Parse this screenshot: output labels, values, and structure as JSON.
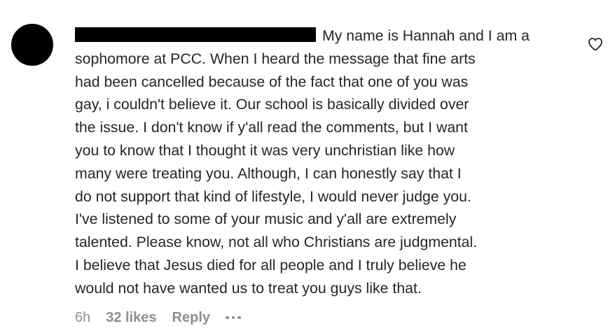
{
  "comment": {
    "lines": [
      "My name is Hannah and I am a",
      "sophomore at PCC. When I heard the message that fine arts",
      "had been cancelled because of the fact that one of you was",
      "gay, i couldn't believe it. Our school is basically divided over",
      "the issue. I don't know if y'all read the comments, but I want",
      "you to know that I thought it was very unchristian like how",
      "many were treating you. Although, I can honestly say that I",
      "do not support that kind of lifestyle, I would never judge you.",
      "I've listened to some of your music and y'all are extremely",
      "talented. Please know, not all who Christians are judgmental.",
      "I believe that Jesus died for all people and I truly believe he",
      "would not have wanted us to treat you guys like that."
    ]
  },
  "meta": {
    "time": "6h",
    "likes": "32 likes",
    "reply": "Reply"
  },
  "icons": {
    "like": "heart-icon",
    "more": "more-options-icon"
  }
}
